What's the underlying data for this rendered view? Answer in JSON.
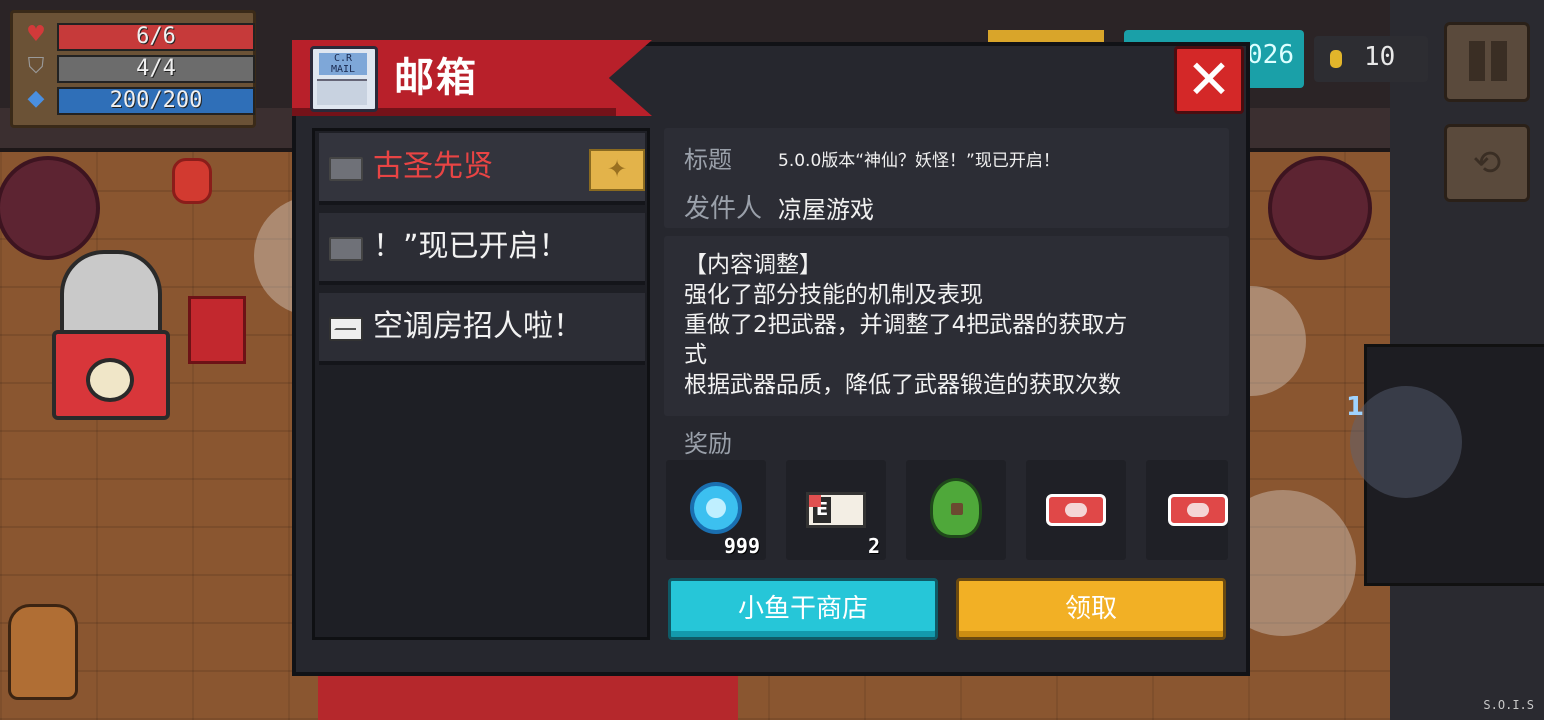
{
  "hud": {
    "hp": {
      "text": "6/6",
      "icon": "heart-icon",
      "color": "#d23a3a",
      "fill": 1.0
    },
    "armor": {
      "text": "4/4",
      "icon": "shield-icon",
      "color": "#8a8a8a",
      "fill": 1.0
    },
    "energy": {
      "text": "200/200",
      "icon": "diamond-icon",
      "color": "#2f7fc8",
      "fill": 1.0
    },
    "teal_value": "026",
    "coins": "10"
  },
  "weapon_slot_number": "1",
  "watermark": "S.O.I.S",
  "mailbox": {
    "title": "邮箱",
    "mail_icon_text": "C.R MAIL",
    "close_glyph": "✕",
    "mails": [
      {
        "subject": "古圣先贤",
        "unread": false,
        "highlight": true,
        "badge": "✦"
      },
      {
        "subject": "！”现已开启！",
        "unread": false,
        "highlight": false
      },
      {
        "subject": "空调房招人啦！",
        "unread": true,
        "highlight": false
      }
    ],
    "detail": {
      "title_label": "标题",
      "title_value": "5.0.0版本“神仙？妖怪！”现已开启！",
      "sender_label": "发件人",
      "sender_value": "凉屋游戏",
      "body_lines": [
        "【内容调整】",
        "强化了部分技能的机制及表现",
        "重做了2把武器，并调整了4把武器的获取方",
        "式",
        "根据武器品质，降低了武器锻造的获取次数"
      ],
      "reward_label": "奖励",
      "rewards": [
        {
          "icon": "gem-icon",
          "count": "999"
        },
        {
          "icon": "card-icon",
          "count": "2"
        },
        {
          "icon": "pet-icon",
          "count": ""
        },
        {
          "icon": "ticket-icon",
          "count": ""
        },
        {
          "icon": "ticket-icon",
          "count": ""
        }
      ]
    },
    "buttons": {
      "shop": "小鱼干商店",
      "claim": "领取"
    }
  }
}
